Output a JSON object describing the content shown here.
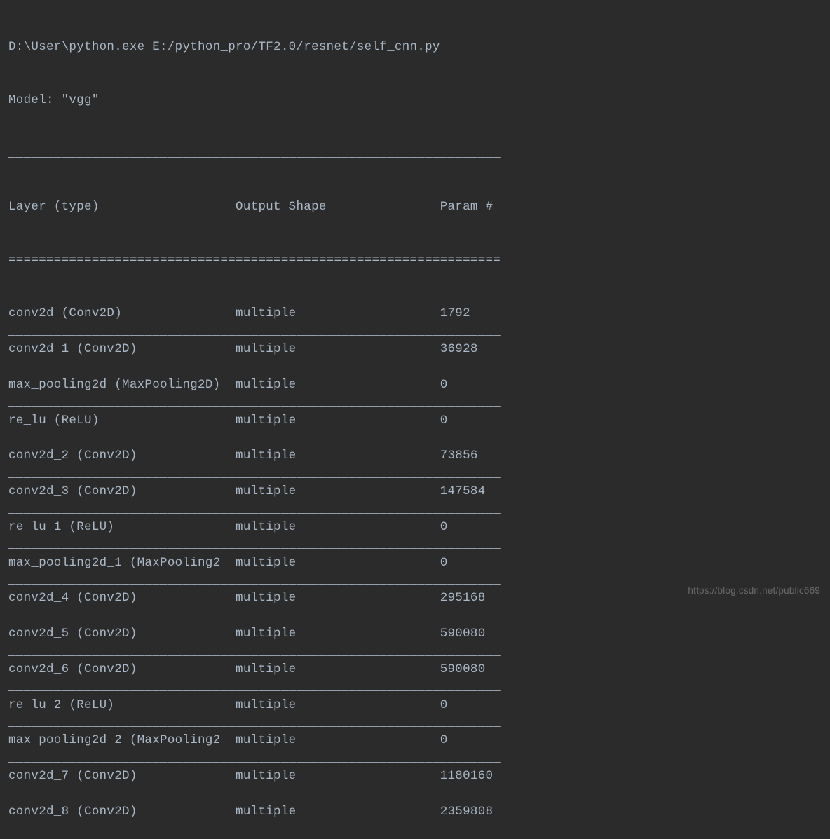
{
  "console": {
    "command": "D:\\User\\python.exe E:/python_pro/TF2.0/resnet/self_cnn.py",
    "model_line": "Model: \"vgg\"",
    "header": {
      "col1": "Layer (type)",
      "col2": "Output Shape",
      "col3": "Param #"
    },
    "rows": [
      {
        "layer": "conv2d (Conv2D)",
        "output": "multiple",
        "params": "1792"
      },
      {
        "layer": "conv2d_1 (Conv2D)",
        "output": "multiple",
        "params": "36928"
      },
      {
        "layer": "max_pooling2d (MaxPooling2D)",
        "output": "multiple",
        "params": "0"
      },
      {
        "layer": "re_lu (ReLU)",
        "output": "multiple",
        "params": "0"
      },
      {
        "layer": "conv2d_2 (Conv2D)",
        "output": "multiple",
        "params": "73856"
      },
      {
        "layer": "conv2d_3 (Conv2D)",
        "output": "multiple",
        "params": "147584"
      },
      {
        "layer": "re_lu_1 (ReLU)",
        "output": "multiple",
        "params": "0"
      },
      {
        "layer": "max_pooling2d_1 (MaxPooling2",
        "output": "multiple",
        "params": "0"
      },
      {
        "layer": "conv2d_4 (Conv2D)",
        "output": "multiple",
        "params": "295168"
      },
      {
        "layer": "conv2d_5 (Conv2D)",
        "output": "multiple",
        "params": "590080"
      },
      {
        "layer": "conv2d_6 (Conv2D)",
        "output": "multiple",
        "params": "590080"
      },
      {
        "layer": "re_lu_2 (ReLU)",
        "output": "multiple",
        "params": "0"
      },
      {
        "layer": "max_pooling2d_2 (MaxPooling2",
        "output": "multiple",
        "params": "0"
      },
      {
        "layer": "conv2d_7 (Conv2D)",
        "output": "multiple",
        "params": "1180160"
      },
      {
        "layer": "conv2d_8 (Conv2D)",
        "output": "multiple",
        "params": "2359808"
      }
    ]
  },
  "watermark": "https://blog.csdn.net/public669"
}
